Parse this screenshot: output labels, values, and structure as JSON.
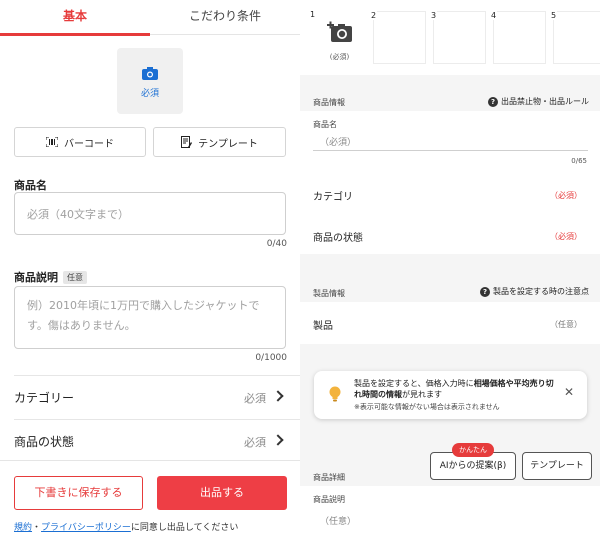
{
  "left": {
    "tabs": [
      "基本",
      "こだわり条件"
    ],
    "photo": {
      "label": "必須",
      "icon": "camera-icon"
    },
    "buttons": {
      "barcode": "バーコード",
      "template": "テンプレート"
    },
    "title": {
      "label": "商品名",
      "placeholder": "必須（40文字まで）",
      "counter": "0/40"
    },
    "description": {
      "label": "商品説明",
      "tag": "任意",
      "placeholder": "例）2010年頃に1万円で購入したジャケットです。傷はありません。",
      "counter": "0/1000"
    },
    "category": {
      "label": "カテゴリー",
      "value": "必須"
    },
    "condition": {
      "label": "商品の状態",
      "value": "必須"
    },
    "actions": {
      "draft": "下書きに保存する",
      "submit": "出品する"
    },
    "terms": {
      "link1": "規約",
      "sep": "・",
      "link2": "プライバシーポリシー",
      "rest": "に同意し出品してください"
    }
  },
  "right": {
    "slots": [
      {
        "n": "1",
        "label": "(必須)"
      },
      {
        "n": "2"
      },
      {
        "n": "3"
      },
      {
        "n": "4"
      },
      {
        "n": "5"
      }
    ],
    "product_info": {
      "header": "商品情報",
      "link": "出品禁止物・出品ルール"
    },
    "name": {
      "label": "商品名",
      "placeholder": "（必須）",
      "counter": "0/65"
    },
    "category": {
      "label": "カテゴリ",
      "value": "（必須）"
    },
    "condition": {
      "label": "商品の状態",
      "value": "（必須）"
    },
    "item_info": {
      "header": "製品情報",
      "link": "製品を設定する時の注意点"
    },
    "item": {
      "label": "製品",
      "value": "（任意）"
    },
    "toast": {
      "line1a": "製品を設定すると、価格入力時に",
      "line1b": "相場価格や平均売り切れ時間の情報",
      "line1c": "が見れます",
      "note": "※表示可能な情報がない場合は表示されません"
    },
    "badge": "かんたん",
    "ai_button": "AIからの提案(β)",
    "template_button": "テンプレート",
    "details": {
      "header": "商品詳細",
      "desc_label": "商品説明",
      "desc_placeholder": "（任意）"
    }
  },
  "colors": {
    "accent": "#e63b3b",
    "link": "#1b6fd3"
  }
}
